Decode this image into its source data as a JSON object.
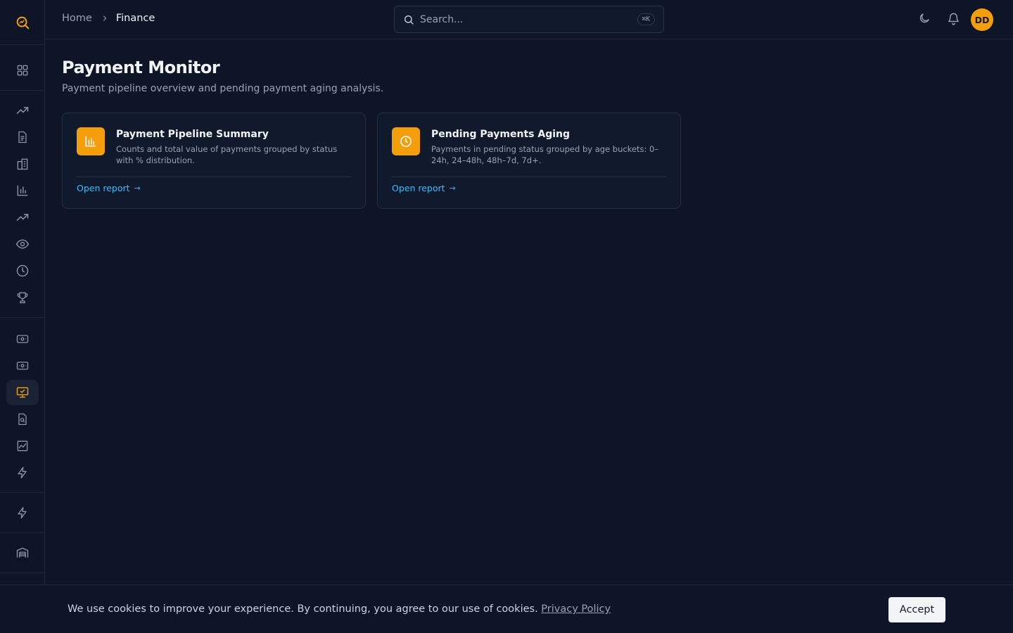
{
  "breadcrumb": {
    "home": "Home",
    "current": "Finance"
  },
  "search": {
    "placeholder": "Search...",
    "shortcut": "⌘K"
  },
  "user": {
    "initials": "DD"
  },
  "page": {
    "title": "Payment Monitor",
    "subtitle": "Payment pipeline overview and pending payment aging analysis."
  },
  "cards": [
    {
      "title": "Payment Pipeline Summary",
      "description": "Counts and total value of payments grouped by status with % distribution.",
      "link": "Open report",
      "icon": "bar-chart-icon"
    },
    {
      "title": "Pending Payments Aging",
      "description": "Payments in pending status grouped by age buckets: 0–24h, 24–48h, 48h–7d, 7d+.",
      "link": "Open report",
      "icon": "clock-icon"
    }
  ],
  "cookie": {
    "text": "We use cookies to improve your experience. By continuing, you agree to our use of cookies.",
    "link": "Privacy Policy",
    "accept": "Accept"
  },
  "colors": {
    "accent": "#f59e0b",
    "link": "#38bdf8",
    "background": "#0d1527"
  }
}
